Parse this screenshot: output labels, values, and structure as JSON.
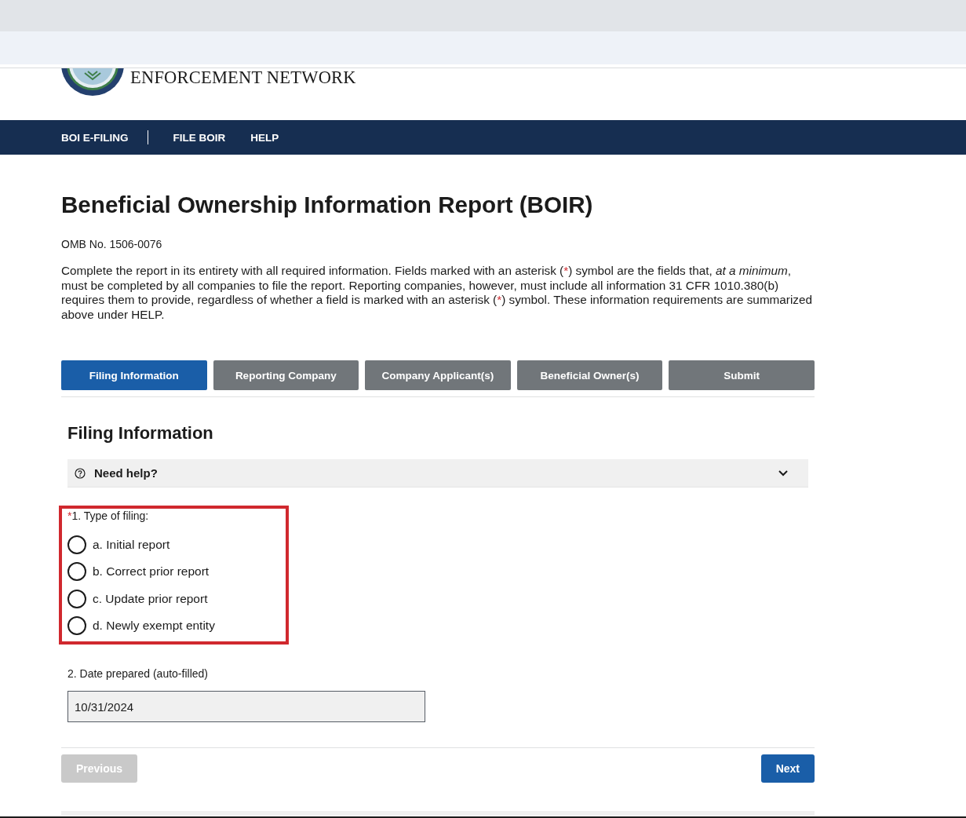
{
  "agency": {
    "name": "ENFORCEMENT NETWORK"
  },
  "nav": {
    "home": "BOI E-FILING",
    "links": [
      "FILE BOIR",
      "HELP"
    ]
  },
  "page_title": "Beneficial Ownership Information Report (BOIR)",
  "omb_number": "OMB No. 1506-0076",
  "intro": [
    {
      "kind": "text",
      "text": "Complete the report in its entirety with all required information. Fields marked with an asterisk ("
    },
    {
      "kind": "required",
      "text": "*"
    },
    {
      "kind": "text",
      "text": ") symbol are the fields that, *at a minimum*, must be completed by all companies to file the report. Reporting companies, however, must include all information 31 CFR 1010.380(b) requires them to provide, regardless of whether a field is marked with an asterisk ("
    },
    {
      "kind": "required",
      "text": "*"
    },
    {
      "kind": "text",
      "text": ") symbol. These information requirements are summarized above under HELP."
    }
  ],
  "tabs": [
    {
      "label": "Filing Information",
      "selected": true
    },
    {
      "label": "Reporting Company",
      "selected": false
    },
    {
      "label": "Company Applicant(s)",
      "selected": false
    },
    {
      "label": "Beneficial Owner(s)",
      "selected": false
    },
    {
      "label": "Submit",
      "selected": false
    }
  ],
  "section": {
    "title": "Filing Information",
    "help": {
      "label": "Need help?",
      "expanded": false
    }
  },
  "filing_type": {
    "required_mark": "*",
    "label": "1. Type of filing:",
    "highlighted": true,
    "options": [
      {
        "label": "a. Initial report",
        "selected": false
      },
      {
        "label": "b. Correct prior report",
        "selected": false
      },
      {
        "label": "c. Update prior report",
        "selected": false
      },
      {
        "label": "d. Newly exempt entity",
        "selected": false
      }
    ]
  },
  "date_prepared": {
    "label": "2. Date prepared (auto-filled)",
    "value": "10/31/2024"
  },
  "footer_buttons": {
    "previous": {
      "label": "Previous",
      "disabled": true
    },
    "next": {
      "label": "Next",
      "disabled": false
    }
  }
}
